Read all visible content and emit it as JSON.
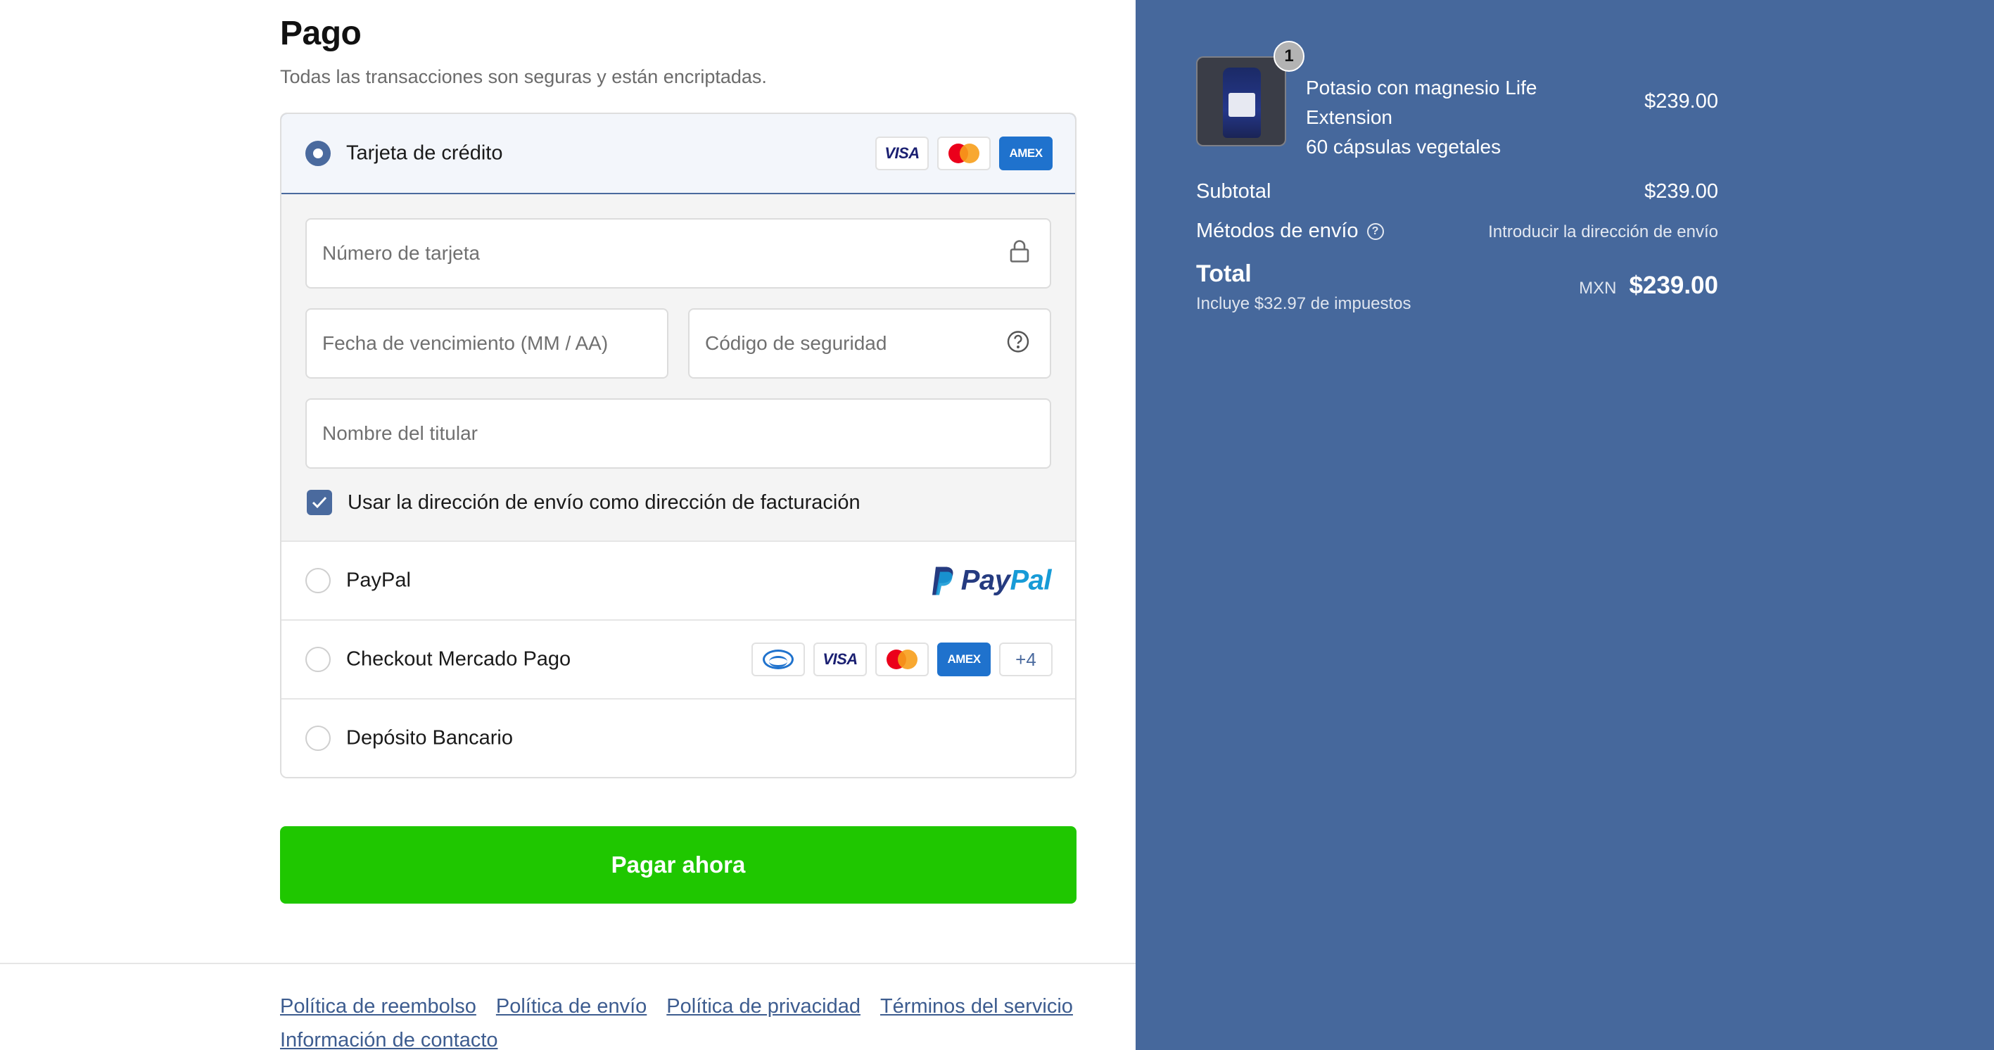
{
  "payment": {
    "title": "Pago",
    "subtitle": "Todas las transacciones son seguras y están encriptadas.",
    "methods": {
      "credit_card": {
        "label": "Tarjeta de crédito",
        "logos": [
          "VISA",
          "Mastercard",
          "AMEX"
        ]
      },
      "paypal": {
        "label": "PayPal",
        "logo_text_1": "Pay",
        "logo_text_2": "Pal"
      },
      "mercado_pago": {
        "label": "Checkout Mercado Pago",
        "more_count": "+4"
      },
      "bank": {
        "label": "Depósito Bancario"
      }
    },
    "card_form": {
      "number_placeholder": "Número de tarjeta",
      "expiry_placeholder": "Fecha de vencimiento (MM / AA)",
      "cvc_placeholder": "Código de seguridad",
      "name_placeholder": "Nombre del titular",
      "billing_checkbox_label": "Usar la dirección de envío como dirección de facturación",
      "billing_checked": true
    },
    "selected_method": "credit_card",
    "pay_button": "Pagar ahora"
  },
  "footer": {
    "links": [
      "Política de reembolso",
      "Política de envío",
      "Política de privacidad",
      "Términos del servicio"
    ],
    "contact": "Información de contacto"
  },
  "summary": {
    "product": {
      "quantity": "1",
      "name": "Potasio con magnesio Life Extension",
      "variant": "60 cápsulas vegetales",
      "price": "$239.00"
    },
    "subtotal_label": "Subtotal",
    "subtotal_value": "$239.00",
    "shipping_label": "Métodos de envío",
    "shipping_value": "Introducir la dirección de envío",
    "total_label": "Total",
    "tax_note": "Incluye $32.97 de impuestos",
    "currency": "MXN",
    "total_value": "$239.00"
  },
  "colors": {
    "accent": "#4a6a9e",
    "summary_bg": "#46689c",
    "pay_button": "#1fc700",
    "link": "#3d5c8f"
  }
}
